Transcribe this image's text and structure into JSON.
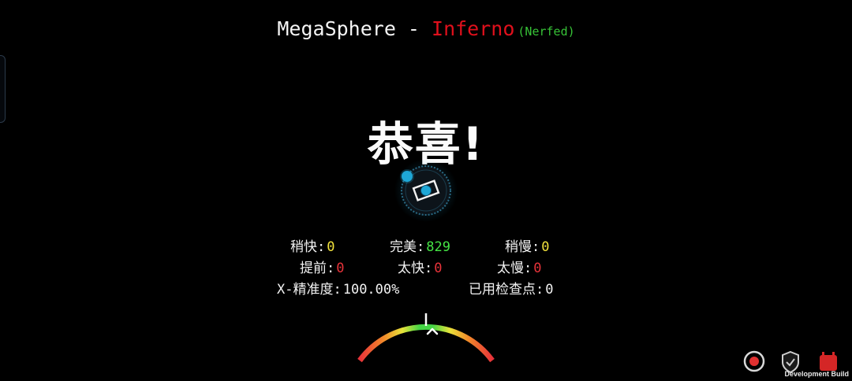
{
  "header": {
    "song": "MegaSphere",
    "separator": " - ",
    "difficulty": "Inferno",
    "tag": "(Nerfed)"
  },
  "congrats": "恭喜!",
  "stats": {
    "early": {
      "label": "稍快:",
      "value": "0"
    },
    "perfect": {
      "label": "完美:",
      "value": "829"
    },
    "late": {
      "label": "稍慢:",
      "value": "0"
    },
    "too_early_prev": {
      "label": "提前:",
      "value": "0"
    },
    "too_early": {
      "label": "太快:",
      "value": "0"
    },
    "too_late": {
      "label": "太慢:",
      "value": "0"
    },
    "x_accuracy": {
      "label": "X-精准度:",
      "value": "100.00%"
    },
    "checkpoints": {
      "label": "已用检查点:",
      "value": "0"
    }
  },
  "footer": {
    "dev_build": "Development Build"
  },
  "colors": {
    "difficulty": "#e0101c",
    "tag": "#37c337",
    "early_late": "#f2e23c",
    "perfect": "#45e545",
    "miss": "#e8333a",
    "planet": "#1ea7d6"
  },
  "icons": [
    "record-icon",
    "shield-icon",
    "calendar-icon"
  ]
}
